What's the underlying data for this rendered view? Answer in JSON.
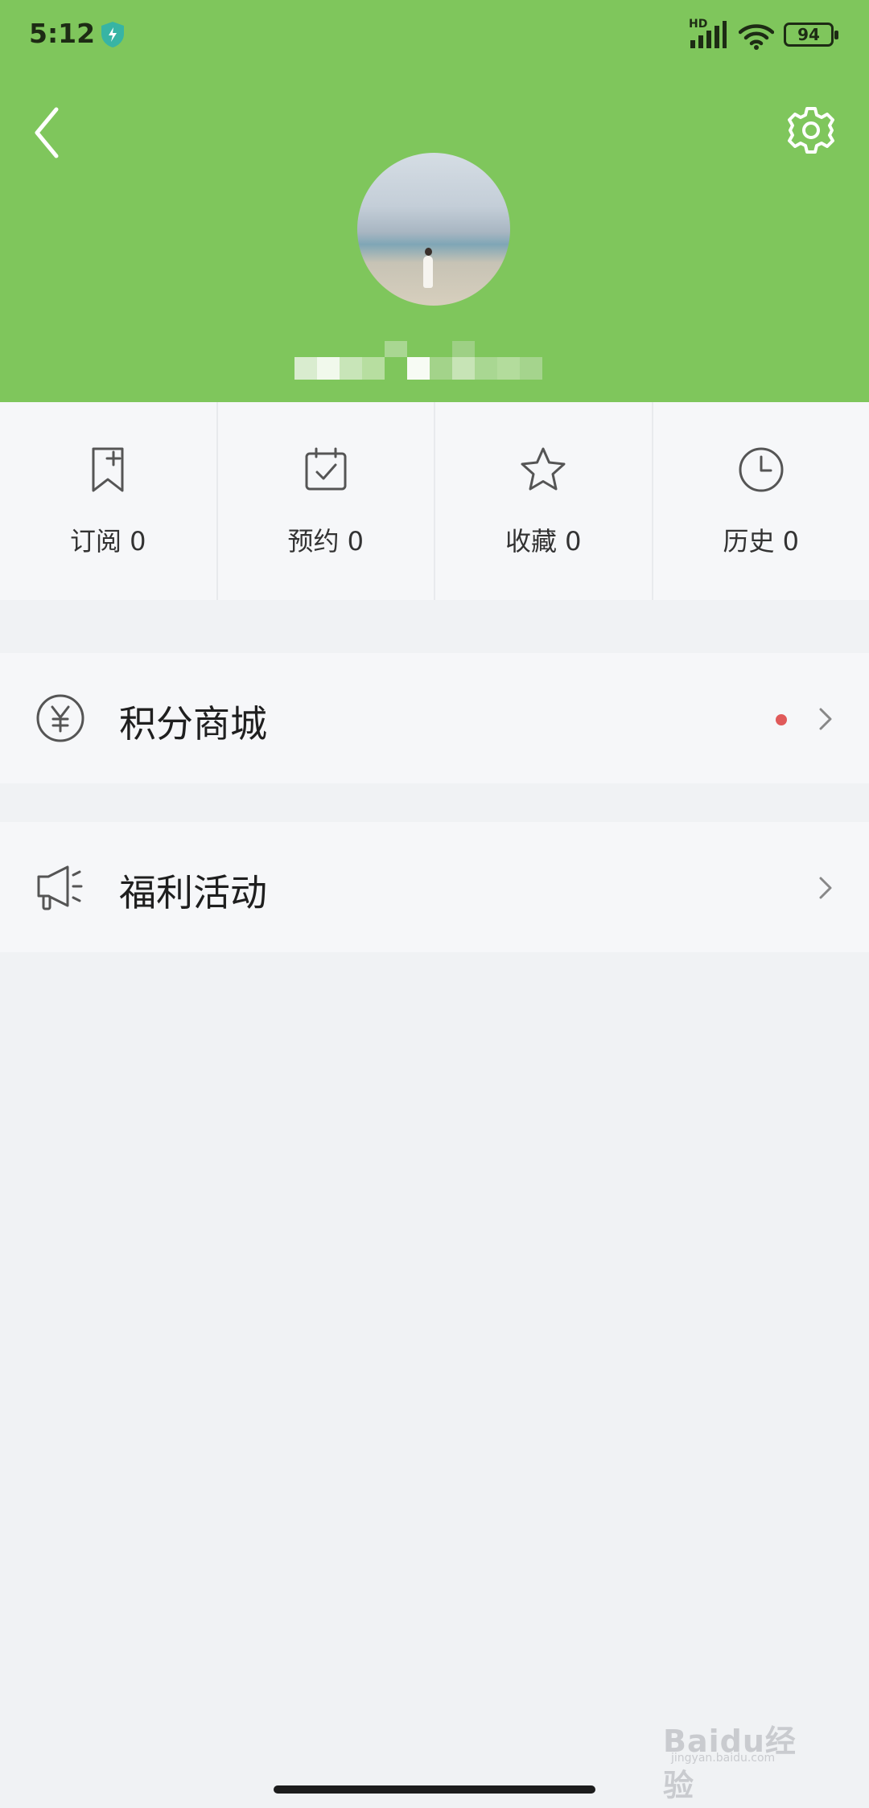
{
  "status_bar": {
    "time": "5:12",
    "network": "HD",
    "battery": "94"
  },
  "header": {
    "background_color": "#7fc65c",
    "back_icon": "back-arrow-icon",
    "settings_icon": "gear-icon"
  },
  "stats": [
    {
      "label": "订阅 0",
      "icon": "bookmark-plus-icon"
    },
    {
      "label": "预约 0",
      "icon": "calendar-check-icon"
    },
    {
      "label": "收藏 0",
      "icon": "star-icon"
    },
    {
      "label": "历史 0",
      "icon": "clock-icon"
    }
  ],
  "menu": [
    {
      "label": "积分商城",
      "icon": "yuan-coin-icon",
      "has_badge": true
    },
    {
      "label": "福利活动",
      "icon": "megaphone-icon",
      "has_badge": false
    }
  ],
  "watermark": {
    "text": "Baidu经验",
    "url": "jingyan.baidu.com"
  }
}
